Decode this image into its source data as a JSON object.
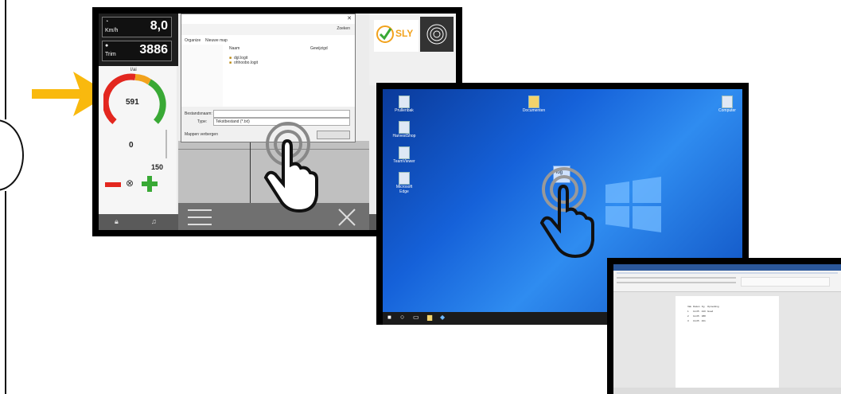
{
  "screen1": {
    "speed_value": "8,0",
    "speed_unit": "Km/h",
    "rpm_value": "3886",
    "rpm_unit": "Trim",
    "gauge_top_label": "l/ai",
    "gauge_value": "591",
    "counter_value": "0",
    "setpoint_value": "150",
    "logo_text": "SLY",
    "dialog": {
      "organize_label": "Organize",
      "new_folder_label": "Nieuwe map",
      "col_name": "Naam",
      "col_date": "Gewijzigd",
      "file1": "dgl.logit",
      "file2": "ohhoobo.logit",
      "filename_label": "Bestandsnaam:",
      "type_label": "Type:",
      "type_value": "Tekstbestand (*.txt)",
      "hide_folders_label": "Mappen verbergen",
      "search_placeholder": "Zoeken"
    }
  },
  "screen2": {
    "desktop_icons": [
      "Prullenbak",
      "HarvestShop",
      "TeamViewer",
      "Microsoft Edge"
    ],
    "top_icon_center": "Documenten",
    "top_icon_right": "Computer",
    "dragged_file_label": "log"
  },
  "screen3": {
    "doc_table_rows": [
      [
        "Vak",
        "Datum",
        "Kg",
        "Opmerking"
      ],
      [
        "1",
        "12-05",
        "420",
        "Goed"
      ],
      [
        "2",
        "12-05",
        "388",
        ""
      ],
      [
        "3",
        "13-05",
        "401",
        ""
      ]
    ]
  },
  "colors": {
    "arrow": "#f9b90e",
    "gauge_green": "#39a935",
    "gauge_red": "#e3271f",
    "desktop_blue": "#1561d9",
    "word_blue": "#2b579a"
  },
  "icons": [
    "arrow-right-icon",
    "tap-hand-icon",
    "menu-icon",
    "close-icon",
    "minus-icon",
    "plus-icon",
    "target-icon",
    "fingerprint-icon"
  ]
}
